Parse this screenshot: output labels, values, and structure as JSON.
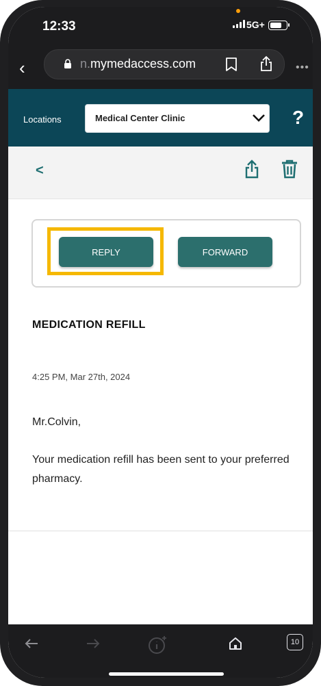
{
  "status_bar": {
    "time": "12:33",
    "network": "5G+"
  },
  "browser": {
    "url_prefix": "n.",
    "url_domain": "mymedaccess.com",
    "icons": [
      "back-chevron-icon",
      "lock-icon",
      "bookmark-icon",
      "share-icon",
      "more-icon"
    ]
  },
  "location_bar": {
    "label": "Locations",
    "selected_location": "Medical Center Clinic",
    "help": "?"
  },
  "action_bar": {
    "back": "<"
  },
  "message": {
    "reply_label": "REPLY",
    "forward_label": "FORWARD",
    "subject": "MEDICATION REFILL",
    "date": "4:25 PM, Mar 27th, 2024",
    "salutation": "Mr.Colvin,",
    "body": "Your medication refill has been sent to your preferred pharmacy."
  },
  "toolbar": {
    "tabs_count": "10"
  },
  "colors": {
    "header_teal": "#0c4657",
    "button_teal": "#2c6f6d",
    "highlight": "#f5b800"
  }
}
